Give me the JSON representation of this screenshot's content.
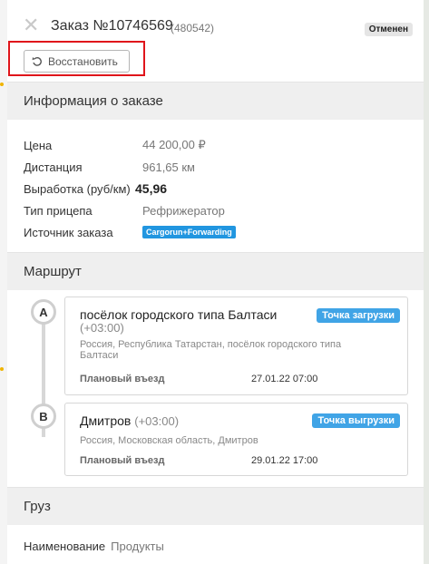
{
  "header": {
    "title": "Заказ №10746569",
    "subtitle": "(480542)",
    "status": "Отменен",
    "restore_label": "Восстановить"
  },
  "order_info": {
    "section_title": "Информация о заказе",
    "rows": [
      {
        "label": "Цена",
        "value": "44 200,00 ₽"
      },
      {
        "label": "Дистанция",
        "value": "961,65 км"
      },
      {
        "label": "Выработка (руб/км)",
        "value": "45,96"
      },
      {
        "label": "Тип прицепа",
        "value": "Рефрижератор"
      },
      {
        "label": "Источник заказа",
        "value": "Cargorun+Forwarding"
      }
    ]
  },
  "route": {
    "section_title": "Маршрут",
    "points": [
      {
        "marker": "A",
        "city": "посёлок городского типа Балтаси",
        "tz": "(+03:00)",
        "address": "Россия, Республика Татарстан, посёлок городского типа Балтаси",
        "type": "Точка загрузки",
        "plan_label": "Плановый въезд",
        "plan_value": "27.01.22 07:00"
      },
      {
        "marker": "B",
        "city": "Дмитров",
        "tz": "(+03:00)",
        "address": "Россия, Московская область, Дмитров",
        "type": "Точка выгрузки",
        "plan_label": "Плановый въезд",
        "plan_value": "29.01.22 17:00"
      }
    ]
  },
  "cargo": {
    "section_title": "Груз",
    "label": "Наименование",
    "value": "Продукты"
  },
  "colors": {
    "accent_blue": "#2196e0",
    "highlight_red": "#e0151b"
  }
}
